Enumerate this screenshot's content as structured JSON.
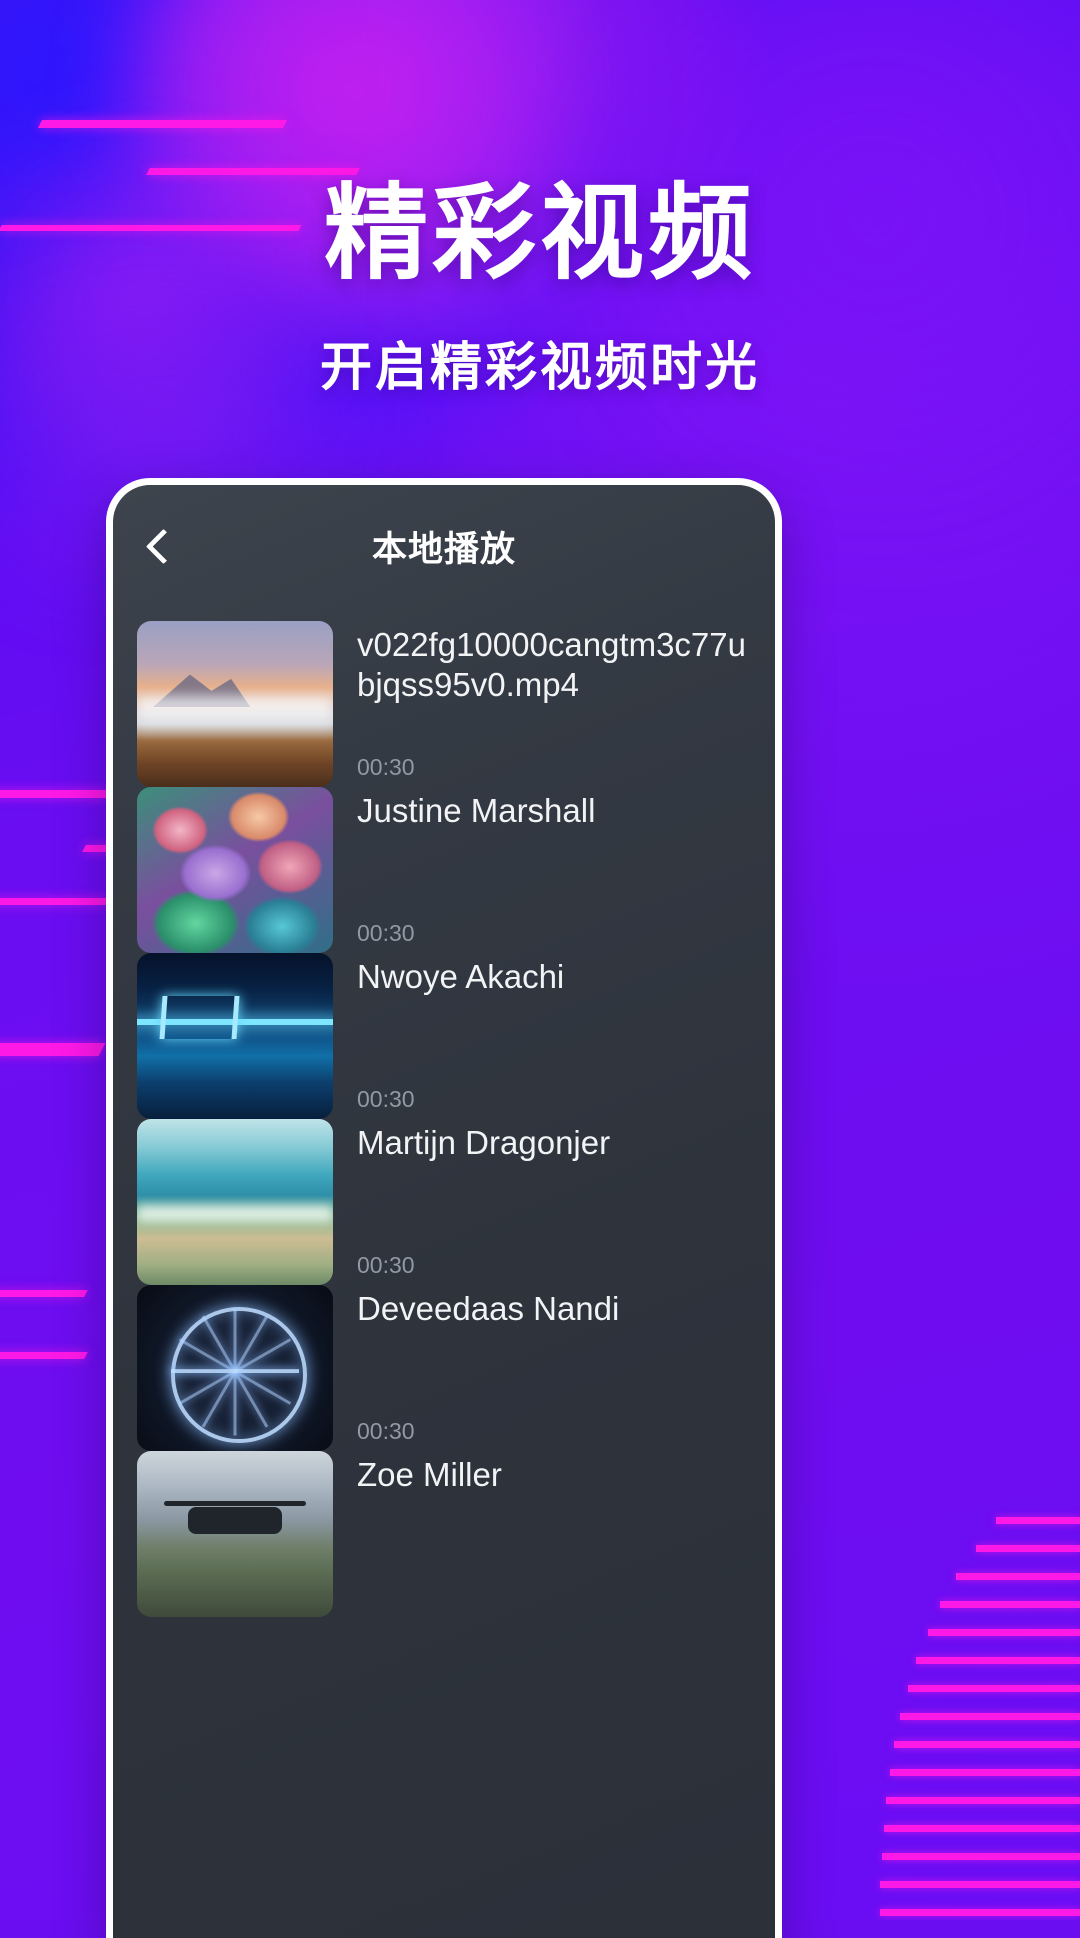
{
  "hero": {
    "title": "精彩视频",
    "subtitle": "开启精彩视频时光"
  },
  "phone": {
    "appbar": {
      "back_icon": "chevron-left-icon",
      "title": "本地播放"
    },
    "list": {
      "items": [
        {
          "title": "v022fg10000cangtm3c77ubjqss95v0.mp4",
          "duration": "00:30",
          "thumb": "t-mountain",
          "thumb_name": "mountain-sunset-thumbnail"
        },
        {
          "title": "Justine Marshall",
          "duration": "00:30",
          "thumb": "t-coral",
          "thumb_name": "coral-reef-thumbnail"
        },
        {
          "title": "Nwoye Akachi",
          "duration": "00:30",
          "thumb": "t-bridge",
          "thumb_name": "night-bridge-thumbnail"
        },
        {
          "title": "Martijn Dragonjer",
          "duration": "00:30",
          "thumb": "t-coast",
          "thumb_name": "coastline-thumbnail"
        },
        {
          "title": "Deveedaas Nandi",
          "duration": "00:30",
          "thumb": "t-wheel",
          "thumb_name": "ferris-wheel-thumbnail"
        },
        {
          "title": "Zoe Miller",
          "duration": "",
          "thumb": "t-drone",
          "thumb_name": "drone-landscape-thumbnail"
        }
      ]
    }
  },
  "colors": {
    "background_purple": "#6a0df0",
    "background_blue": "#1b1aff",
    "accent_magenta": "#ff19e6",
    "card_dark": "#2e333c",
    "text_primary": "#f2f3f5",
    "text_muted": "#9099a4"
  }
}
